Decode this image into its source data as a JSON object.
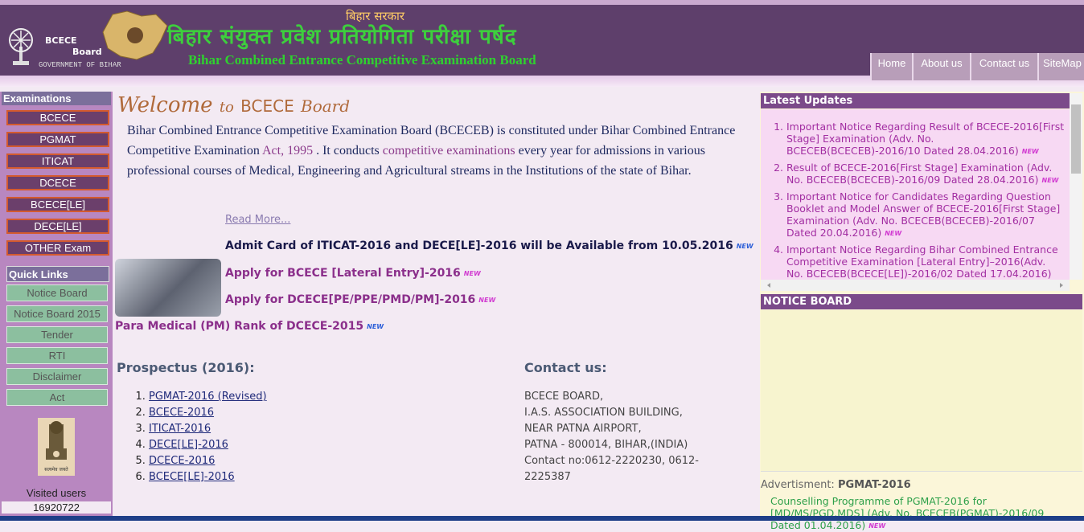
{
  "header": {
    "logo_text_1": "BCECE",
    "logo_text_2": "Board",
    "logo_gov": "GOVERNMENT OF BIHAR",
    "bihar_sarkar": "बिहार सरकार",
    "hindi_title": "बिहार संयुक्त प्रवेश प्रतियोगिता परीक्षा पर्षद",
    "english_title": "Bihar Combined Entrance Competitive Examination Board",
    "tabs": [
      "Home",
      "About us",
      "Contact us",
      "SiteMap"
    ]
  },
  "sidebar": {
    "examinations_heading": "Examinations",
    "exams": [
      "BCECE",
      "PGMAT",
      "ITICAT",
      "DCECE",
      "BCECE[LE]",
      "DECE[LE]",
      "OTHER Exam"
    ],
    "quicklinks_heading": "Quick Links",
    "quicklinks": [
      "Notice Board",
      "Notice Board 2015",
      "Tender",
      "RTI",
      "Disclaimer",
      "Act"
    ],
    "emblem_caption": "सत्यमेव जयते",
    "visited_label": "Visited users",
    "visited_count": "16920722"
  },
  "main": {
    "welcome_1": "Welcome",
    "welcome_2": "to",
    "welcome_3": "BCECE",
    "welcome_4": "Board",
    "intro_1": "Bihar Combined Entrance Competitive Examination Board (BCECEB) is constituted under Bihar Combined Entrance Competitive Examination ",
    "intro_act": "Act, 1995",
    "intro_2": " . It conducts ",
    "intro_competitive": "competitive examinations",
    "intro_3": " every year for admissions in various professional courses of Medical, Engineering and Agricultural streams in the Institutions of the state of Bihar.",
    "read_more": "Read More...",
    "admit_card": "Admit Card of ITICAT-2016 and DECE[LE]-2016 will be Available from 10.05.2016",
    "new_badge": "NEW",
    "apply_bcece_le": "Apply for BCECE [Lateral Entry]-2016",
    "apply_dcece": "Apply for DCECE[PE/PPE/PMD/PM]-2016",
    "para_medical": "Para Medical (PM) Rank of DCECE-2015",
    "prospectus_heading": "Prospectus (2016):",
    "prospectus": [
      "PGMAT-2016 (Revised)",
      "BCECE-2016",
      "ITICAT-2016",
      "DECE[LE]-2016",
      "DCECE-2016",
      "BCECE[LE]-2016"
    ],
    "contact_heading": "Contact us:",
    "contact_lines": [
      "BCECE BOARD,",
      "I.A.S. ASSOCIATION BUILDING,",
      "NEAR PATNA AIRPORT,",
      "PATNA - 800014, BIHAR,(INDIA)",
      "Contact no:0612-2220230, 0612-",
      "2225387"
    ]
  },
  "right": {
    "latest_heading": "Latest Updates",
    "updates": [
      "Important Notice Regarding Result of BCECE-2016[First Stage] Examination (Adv. No. BCECEB(BCECEB)-2016/10 Dated 28.04.2016)",
      "Result of BCECE-2016[First Stage] Examination (Adv. No. BCECEB(BCECEB)-2016/09 Dated 28.04.2016)",
      "Important Notice for Candidates Regarding Question Booklet and Model Answer of BCECE-2016[First Stage] Examination (Adv. No. BCECEB(BCECEB)-2016/07 Dated 20.04.2016)",
      "Important Notice Regarding Bihar Combined Entrance Competitive Examination [Lateral Entry]–2016(Adv. No. BCECEB(BCECE[LE])-2016/02 Dated 17.04.2016)"
    ],
    "notice_board_heading": "NOTICE BOARD",
    "advertisment_label": "Advertisment:",
    "advertisment_value": "PGMAT-2016",
    "adv_link": "Counselling Programme of PGMAT-2016 for [MD/MS/PGD,MDS] (Adv. No. BCECEB(PGMAT)-2016/09 Dated 01.04.2016)"
  }
}
